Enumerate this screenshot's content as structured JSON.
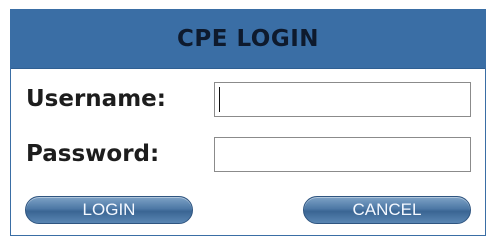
{
  "dialog": {
    "title": "CPE LOGIN",
    "username_label": "Username:",
    "password_label": "Password:",
    "username_value": "",
    "password_value": ""
  },
  "buttons": {
    "login_label": "LOGIN",
    "cancel_label": "CANCEL"
  },
  "colors": {
    "header_bg": "#3a6ea5",
    "border": "#3a6ea5",
    "button_gradient_top": "#7ea2c6",
    "button_gradient_bottom": "#3a6593"
  }
}
